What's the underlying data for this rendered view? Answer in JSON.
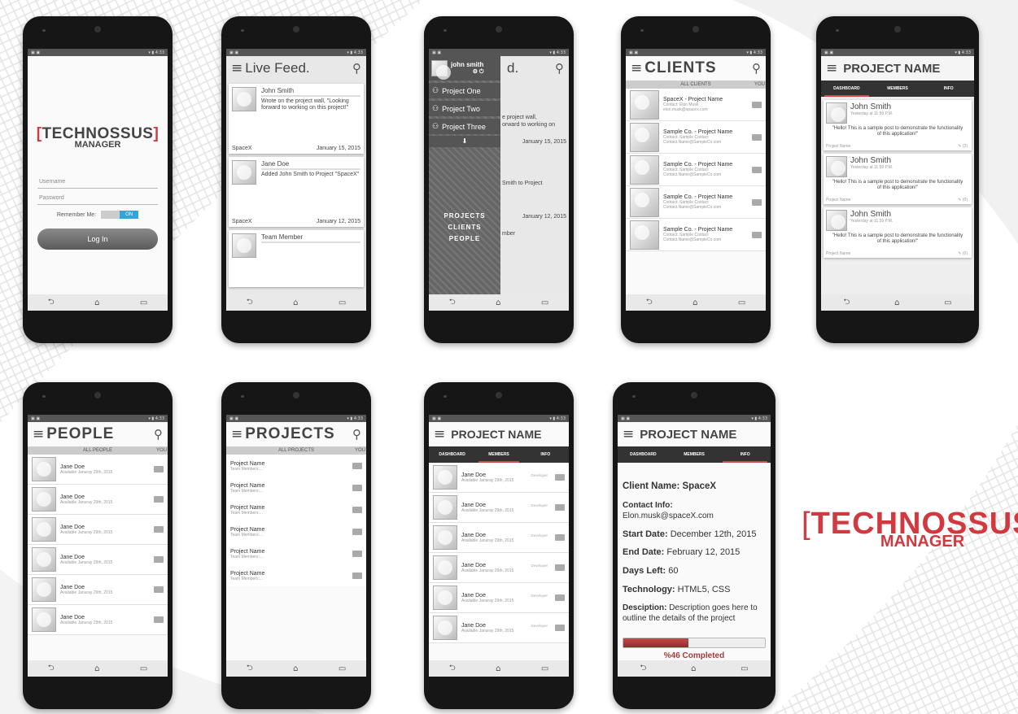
{
  "status": {
    "left": "▣ ▣",
    "right": "▾ ▮ 4:33"
  },
  "nav": {
    "back": "⮌",
    "home": "⌂",
    "recent": "▭"
  },
  "login": {
    "logo_top": "TECHNOSSUS",
    "logo_bottom": "MANAGER",
    "username_placeholder": "Username",
    "password_placeholder": "Password",
    "remember_label": "Remember Me:",
    "toggle": "ON",
    "login_button": "Log In"
  },
  "feed": {
    "title": "Live Feed.",
    "cards": [
      {
        "name": "John Smith",
        "text": "Wrote on the project wall, \"Looking forward to working on this project!\"",
        "org": "SpaceX",
        "date": "January 15, 2015"
      },
      {
        "name": "Jane Doe",
        "text": "Added John Smith to Project \"SpaceX\"",
        "org": "SpaceX",
        "date": "January 12, 2015"
      },
      {
        "name": "Team Member",
        "text": "",
        "org": "",
        "date": ""
      }
    ]
  },
  "drawer": {
    "user": "john smith",
    "projects": [
      "Project One",
      "Project Two",
      "Project Three"
    ],
    "arrow": "⬇",
    "menu": [
      "PROJECTS",
      "CLIENTS",
      "PEOPLE"
    ],
    "behind_title": "d.",
    "behind_texts": [
      "e project wall,",
      "orward to working on",
      "January 15, 2015",
      "Smith to Project",
      "January 12, 2015",
      "mber"
    ]
  },
  "clients": {
    "title": "CLIENTS",
    "tab": "ALL CLIENTS",
    "tab_right": "YOU",
    "items": [
      {
        "name": "SpaceX - Project Name",
        "contact": "Contact: Elon Musk",
        "email": "elon.musk@spacex.com"
      },
      {
        "name": "Sample Co. - Project Name",
        "contact": "Contact: Sample Contact",
        "email": "Contact.Name@SampleCo.com"
      },
      {
        "name": "Sample Co. - Project Name",
        "contact": "Contact: Sample Contact",
        "email": "Contact.Name@SampleCo.com"
      },
      {
        "name": "Sample Co. - Project Name",
        "contact": "Contact: Sample Contact",
        "email": "Contact.Name@SampleCo.com"
      },
      {
        "name": "Sample Co. - Project Name",
        "contact": "Contact: Sample Contact",
        "email": "Contact.Name@SampleCo.com"
      }
    ]
  },
  "project_header": {
    "title": "PROJECT NAME",
    "tabs": [
      "DASHBOARD",
      "MEMBERS",
      "INFO"
    ]
  },
  "dashboard": {
    "posts": [
      {
        "name": "John Smith",
        "time": "Yesterday at 11:59 P.M.",
        "text": "\"Hello! This is a sample post to demonstrate the functionality of this application!\"",
        "project": "Project Name",
        "count": "(2)"
      },
      {
        "name": "John Smith",
        "time": "Yesterday at 11:59 P.M.",
        "text": "\"Hello! This is a sample post to demonstrate the functionality of this application!\"",
        "project": "Project Name",
        "count": "(0)"
      },
      {
        "name": "John Smith",
        "time": "Yesterday at 11:59 P.M.",
        "text": "\"Hello! This is a sample post to demonstrate the functionality of this application!\"",
        "project": "Project Name",
        "count": "(0)"
      }
    ]
  },
  "people": {
    "title": "PEOPLE",
    "tab": "ALL PEOPLE",
    "tab_right": "YOU",
    "items": [
      {
        "name": "Jane Doe",
        "sub": "Available Januray 29th, 2015"
      },
      {
        "name": "Jane Doe",
        "sub": "Available Januray 29th, 2015"
      },
      {
        "name": "Jane Doe",
        "sub": "Available Januray 29th, 2015"
      },
      {
        "name": "Jane Doe",
        "sub": "Available Januray 29th, 2015"
      },
      {
        "name": "Jane Doe",
        "sub": "Available Januray 29th, 2015"
      },
      {
        "name": "Jane Doe",
        "sub": "Available Januray 29th, 2015"
      }
    ]
  },
  "projects": {
    "title": "PROJECTS",
    "tab": "ALL PROJECTS",
    "tab_right": "YOU",
    "items": [
      {
        "name": "Project Name",
        "sub": "Team Members:..."
      },
      {
        "name": "Project Name",
        "sub": "Team Members:..."
      },
      {
        "name": "Project Name",
        "sub": "Team Members:..."
      },
      {
        "name": "Project Name",
        "sub": "Team Members:..."
      },
      {
        "name": "Project Name",
        "sub": "Team Members:..."
      },
      {
        "name": "Project Name",
        "sub": "Team Members:..."
      }
    ]
  },
  "members": {
    "items": [
      {
        "name": "Jane Doe",
        "role": "Developer",
        "sub": "Available Januray 29th, 2015"
      },
      {
        "name": "Jane Doe",
        "role": "Developer",
        "sub": "Available Januray 29th, 2015"
      },
      {
        "name": "Jane Doe",
        "role": "Developer",
        "sub": "Available Januray 29th, 2015"
      },
      {
        "name": "Jane Doe",
        "role": "Developer",
        "sub": "Available Januray 29th, 2015"
      },
      {
        "name": "Jane Doe",
        "role": "Developer",
        "sub": "Available Januray 29th, 2015"
      },
      {
        "name": "Jane Doe",
        "role": "Developer",
        "sub": "Available Januray 29th, 2015"
      }
    ]
  },
  "info": {
    "client_label": "Client Name:",
    "client": "SpaceX",
    "contact_label": "Contact Info:",
    "contact": "Elon.musk@spaceX.com",
    "start_label": "Start Date:",
    "start": "December 12th, 2015",
    "end_label": "End Date:",
    "end": "February 12, 2015",
    "days_label": "Days Left:",
    "days": "60",
    "tech_label": "Technology:",
    "tech": "HTML5, CSS",
    "desc_label": "Desciption:",
    "desc": "Description goes here to outline the details of the project",
    "progress_value": 46,
    "progress_label": "%46 Completed"
  },
  "brand": {
    "top": "TECHNOSSUS",
    "bottom": "MANAGER"
  },
  "colors": {
    "accent": "#d2393f",
    "progress": "#a33b3b"
  }
}
